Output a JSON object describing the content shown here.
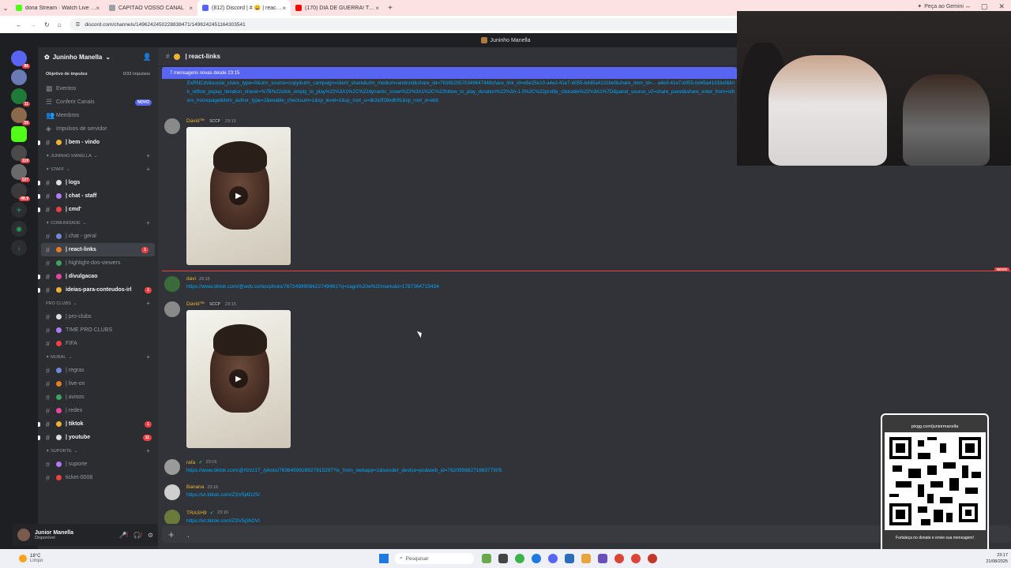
{
  "browser": {
    "tabs": [
      {
        "label": "dona Stream · Watch Live on K",
        "color": "#53fc18"
      },
      {
        "label": "CAPITÃO VOSSO CANAL",
        "color": "#9aa0a6"
      },
      {
        "label": "(812) Discord | # 😀 | react-link",
        "color": "#5865f2"
      },
      {
        "label": "(170) DIA DE GUERRA! TRAIRA",
        "color": "#ff0000"
      }
    ],
    "gemini": "Peça ao Gemini",
    "url": "discord.com/channels/1496242450228838471/1496242451164303541"
  },
  "discord_title": "Juninho Manella",
  "servers": [
    {
      "badge": "86"
    },
    {
      "badge": ""
    },
    {
      "badge": "11"
    },
    {
      "badge": "55"
    },
    {
      "badge": ""
    },
    {
      "badge": "119"
    },
    {
      "badge": "127"
    },
    {
      "badge": "48.9"
    }
  ],
  "guild": {
    "name": "Juninho Manella",
    "boost_label": "Objetivo de impulso",
    "boost_progress": "0/33 Impulsos"
  },
  "nav_items": [
    "Eventos",
    "Conferir Canais",
    "Membros",
    "Impulsos de servidor"
  ],
  "novo_badge": "NOVO",
  "channels_top": [
    {
      "label": "| bem - vindo"
    }
  ],
  "categories": [
    {
      "name": "✦ JUNINHO MANELLA",
      "channels": []
    },
    {
      "name": "✦ STAFF",
      "channels": [
        {
          "label": "| logs",
          "bold": true
        },
        {
          "label": "| chat - staff",
          "bold": true
        },
        {
          "label": "| cmd'",
          "bold": true
        }
      ]
    },
    {
      "name": "✦ COMUNIDADE",
      "channels": [
        {
          "label": "| chat - geral",
          "bold": false
        },
        {
          "label": "| react-links",
          "bold": true,
          "selected": true,
          "badge": "1"
        },
        {
          "label": "| highlight-dos-viewers",
          "bold": false
        },
        {
          "label": "| divulgacao",
          "bold": true
        },
        {
          "label": "ideias-para-conteudos-irl",
          "bold": true,
          "badge": "1"
        }
      ]
    },
    {
      "name": "Pro clubs",
      "channels": [
        {
          "label": "| pro-clubs",
          "bold": false
        },
        {
          "label": "TIME PRO CLUBS",
          "bold": false
        },
        {
          "label": "FIFA",
          "bold": false
        }
      ]
    },
    {
      "name": "✦ MURAL",
      "channels": [
        {
          "label": "| regras",
          "bold": false
        },
        {
          "label": "| live-on",
          "bold": false
        },
        {
          "label": "| avisos",
          "bold": false
        },
        {
          "label": "| redes",
          "bold": false
        },
        {
          "label": "| tiktok",
          "bold": true,
          "badge": "1"
        },
        {
          "label": "| youtube",
          "bold": true,
          "badge": "11"
        }
      ]
    },
    {
      "name": "✦ SUPORTE",
      "channels": [
        {
          "label": "| suporte",
          "bold": false
        },
        {
          "label": "ticket-0008",
          "bold": false
        }
      ]
    }
  ],
  "user": {
    "name": "Junior Manella",
    "status": "Disponível"
  },
  "chat": {
    "channel_name": "| react-links",
    "new_messages_bar": "7 mensagens novas desde 23:15",
    "top_link": "ExRNCdv&social_share_type=0&utm_source=copy&utm_campaign=client_share&utm_medium=android&share_iid=7638525570349647448share_link_id=e5e25e10-a4e3-41e7-b055-bd45a4131bef&share_item_id=... a4e3-41e7-b055-bd45a4131bef&link_reflow_popup_iteration_sharer=%7B%22click_empty_to_play%22%3A1%2C%22dynamic_cover%22%3A1%2C%22follow_to_play_duration%22%3A-1.0%2C%22profile_clickable%22%3A1%7D&panel_source_v2=share_panel&share_enter_from=others_homepage&item_author_type=2&enable_checksum=1&sp_level=1&sp_root_u=dk3icff28edh91&sp_root_d=ebb",
    "new_divider_label": "NOVO",
    "messages": [
      {
        "author": "David™",
        "tag": "SCCP",
        "time": "23:15",
        "type": "video"
      },
      {
        "author": "davi",
        "time": "23:15",
        "link": "https://www.tiktok.com/@wdv.cortes/photo/7672499908422749461?q=zago%20e%20manu&t=1787364715434"
      },
      {
        "author": "David™",
        "tag": "SCCP",
        "time": "23:15",
        "type": "video"
      },
      {
        "author": "rafa",
        "time": "23:16",
        "link": "https://www.tiktok.com/@rfzzz17_/photo/7636459928927915297?is_from_webapp=1&sender_device=pc&web_id=7620956827166377505"
      },
      {
        "author": "Banana",
        "time": "23:16",
        "link": "https://vt.tiktok.com/ZSV5j4D2S/"
      },
      {
        "author": "TRASH9",
        "time": "23:16",
        "link": "https://vt.tiktok.com/ZSV5j3hDV/"
      }
    ],
    "composer_value": "."
  },
  "overlay": {
    "qr_url": "pixgg.com/juniormanella",
    "qr_caption": "Fortaleça no donate e envie sua mensagem!"
  },
  "taskbar": {
    "temp": "18°C",
    "condition": "Limpo",
    "search": "Pesquisar",
    "time": "23:17",
    "date": "21/08/2025"
  },
  "colors": {
    "accent": "#5865f2",
    "danger": "#f23f43",
    "link": "#00a8fc"
  }
}
